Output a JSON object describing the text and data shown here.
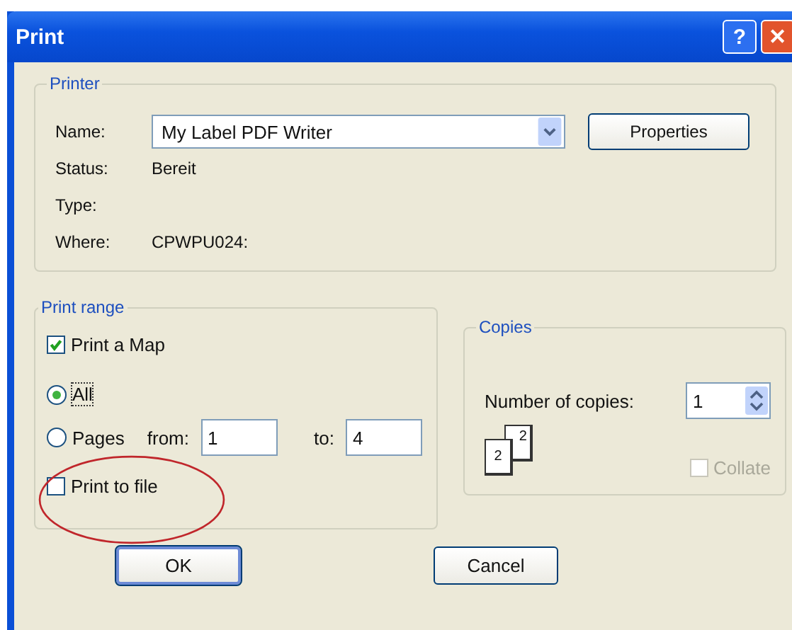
{
  "window": {
    "title": "Print",
    "controls": [
      {
        "kind": "help",
        "label": "?"
      },
      {
        "kind": "close",
        "label": "✕"
      }
    ]
  },
  "printer": {
    "legend": "Printer",
    "name_label": "Name:",
    "name_value": "My Label PDF Writer",
    "properties_button": "Properties",
    "info": [
      {
        "label": "Status:",
        "value": "Bereit"
      },
      {
        "label": "Type:"
      },
      {
        "label": "Where:",
        "value": "CPWPU024:"
      }
    ]
  },
  "print_range": {
    "legend": "Print range",
    "print_map": {
      "label": "Print a Map",
      "checked": true
    },
    "options": [
      {
        "label": "All",
        "selected": true
      },
      {
        "label": "Pages",
        "selected": false
      }
    ],
    "from_label": "from:",
    "from_value": "1",
    "to_label": "to:",
    "to_value": "4",
    "print_to_file": {
      "label": "Print to file",
      "checked": false
    }
  },
  "copies": {
    "legend": "Copies",
    "number_label": "Number of copies:",
    "number_value": "1",
    "icon_pages": [
      "2",
      "2"
    ],
    "collate": {
      "label": "Collate",
      "checked": false,
      "disabled": true
    }
  },
  "annotation": {
    "kind": "ellipse"
  },
  "buttons": [
    {
      "label": "OK",
      "default": true
    },
    {
      "label": "Cancel",
      "default": false
    }
  ]
}
